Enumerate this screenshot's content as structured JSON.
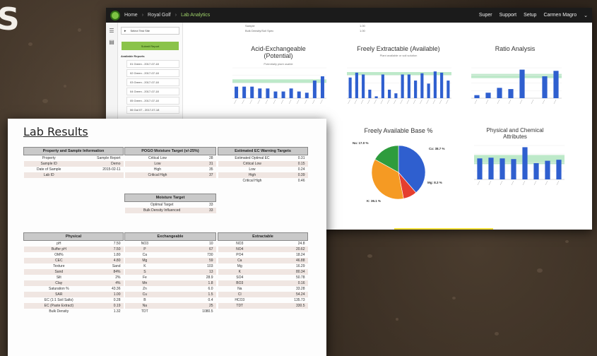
{
  "overlay_letter": "S",
  "dashboard": {
    "breadcrumbs": [
      "Home",
      "Royal Golf",
      "Lab Analytics"
    ],
    "topnav": [
      "Super",
      "Support",
      "Setup",
      "Carmen Magro"
    ],
    "sidepanel": {
      "select_label": "Select Test Site",
      "button_label": "Submit Report",
      "section_heading": "Available Reports",
      "reports": [
        "01 Green - 2017-07-18",
        "02 Green - 2017-07-18",
        "03 Green - 2017-07-18",
        "04 Green - 2017-07-18",
        "05 Green - 2017-07-18",
        "06 Gal 07 - 2017-07-18"
      ]
    },
    "top_notes": [
      "Sample",
      "1.00",
      "Bulk Density/Soil Spec",
      "1.00"
    ],
    "charts": {
      "acid": {
        "title_line1": "Acid-Exchangeable",
        "title_line2": "(Potential)",
        "subtitle": "Potentially plant usable"
      },
      "freely": {
        "title": "Freely Extractable (Available)",
        "subtitle": "Plant available or soil solution"
      },
      "ratio": {
        "title": "Ratio Analysis"
      },
      "base": {
        "title": "Freely Available Base %"
      },
      "physical": {
        "title_line1": "Physical and Chemical",
        "title_line2": "Attributes"
      }
    },
    "colors": {
      "bar": "#2f5fcf",
      "target_band": "#bde9c9",
      "topbar": "#1b1b1b",
      "accent": "#7cc242",
      "highlight": "#f4e13a"
    }
  },
  "chart_data": [
    {
      "type": "bar",
      "title": "Acid-Exchangeable (Potential)",
      "categories": [
        "a",
        "b",
        "c",
        "d",
        "e",
        "f",
        "g",
        "h",
        "i",
        "j",
        "k",
        "l"
      ],
      "values": [
        19,
        19,
        19,
        16,
        16,
        11,
        11,
        16,
        11,
        9,
        29,
        36
      ],
      "ylim": [
        0,
        50
      ],
      "target_band": [
        25,
        31
      ]
    },
    {
      "type": "bar",
      "title": "Freely Extractable (Available)",
      "categories": [
        "a",
        "b",
        "c",
        "d",
        "e",
        "f",
        "g",
        "h",
        "i",
        "j",
        "k",
        "l",
        "m",
        "n",
        "o",
        "p"
      ],
      "values": [
        34,
        42,
        39,
        14,
        3,
        39,
        14,
        8,
        39,
        39,
        29,
        41,
        24,
        44,
        42,
        29
      ],
      "ylim": [
        0,
        50
      ],
      "target_band": [
        38,
        43
      ]
    },
    {
      "type": "bar",
      "title": "Ratio Analysis",
      "categories": [
        "a",
        "b",
        "c",
        "d",
        "e",
        "f",
        "g",
        "h"
      ],
      "values": [
        5,
        9,
        17,
        15,
        47,
        0,
        36,
        45
      ],
      "ylim": [
        0,
        50
      ],
      "target_band": [
        33,
        40
      ]
    },
    {
      "type": "pie",
      "title": "Freely Available Base %",
      "slices": [
        {
          "label": "Ca: 38.7 %",
          "value": 38.7,
          "color": "#2f5fcf"
        },
        {
          "label": "Mg: 8.3 %",
          "value": 8.3,
          "color": "#e53e2f"
        },
        {
          "label": "K: 36.1 %",
          "value": 36.1,
          "color": "#f59a23"
        },
        {
          "label": "Na: 17.0 %",
          "value": 17.0,
          "color": "#2e9c3d"
        }
      ]
    },
    {
      "type": "bar",
      "title": "Physical and Chemical Attributes",
      "categories": [
        "a",
        "b",
        "c",
        "d",
        "e",
        "f",
        "g",
        "h"
      ],
      "values": [
        62,
        64,
        62,
        60,
        95,
        48,
        55,
        58
      ],
      "ylim": [
        0,
        100
      ],
      "target_band": [
        45,
        72
      ]
    }
  ],
  "lab": {
    "title": "Lab Results",
    "property_section": {
      "header": "Property and Sample Information",
      "rows": [
        [
          "Property",
          "Sample Report"
        ],
        [
          "Sample ID",
          "Demo"
        ],
        [
          "Date of Sample",
          "2015-02-11"
        ],
        [
          "Lab ID",
          ""
        ]
      ]
    },
    "pogo_section": {
      "header": "POGO Moisture Target (v/-25%)",
      "rows": [
        [
          "Critical Low",
          "28"
        ],
        [
          "Low",
          "31"
        ],
        [
          "High",
          "35"
        ],
        [
          "Critical High",
          "37"
        ]
      ]
    },
    "moisture_section": {
      "header": "Moisture Target",
      "rows": [
        [
          "Optimal Target",
          "33"
        ],
        [
          "Bulk Density Influenced",
          "33"
        ]
      ]
    },
    "ec_section": {
      "header": "Estimated EC Warning Targets",
      "rows": [
        [
          "Estimated Optimal EC",
          "0.31"
        ],
        [
          "Critical Low",
          "0.15"
        ],
        [
          "Low",
          "0.24"
        ],
        [
          "High",
          "0.39"
        ],
        [
          "Critical High",
          "0.46"
        ]
      ]
    },
    "physical": {
      "header": "Physical",
      "rows": [
        [
          "pH",
          "7.50"
        ],
        [
          "Buffer pH",
          "7.50"
        ],
        [
          "OM%",
          "1.80"
        ],
        [
          "CEC",
          "4.80"
        ],
        [
          "Texture",
          "Sand"
        ],
        [
          "Sand",
          "84%"
        ],
        [
          "Silt",
          "2%"
        ],
        [
          "Clay",
          "4%"
        ],
        [
          "Saturation %",
          "43.36"
        ],
        [
          "SAR",
          "1.00"
        ],
        [
          "EC (1:1 Soil Salts)",
          "0.28"
        ],
        [
          "EC (Paste Extract)",
          "0.19"
        ],
        [
          "Bulk Density",
          "1.32"
        ]
      ]
    },
    "exchangeable": {
      "header": "Exchangeable",
      "rows": [
        [
          "NO3",
          "10"
        ],
        [
          "P",
          "67"
        ],
        [
          "Ca",
          "730"
        ],
        [
          "Mg",
          "59"
        ],
        [
          "K",
          "103"
        ],
        [
          "S",
          "13"
        ],
        [
          "Fe",
          "28.9"
        ],
        [
          "Mn",
          "1.8"
        ],
        [
          "Zn",
          "6.0"
        ],
        [
          "Cu",
          "1.5"
        ],
        [
          "B",
          "0.4"
        ],
        [
          "Na",
          "25"
        ],
        [
          "TDT",
          "1080.5"
        ]
      ]
    },
    "extractable": {
      "header": "Extractable",
      "rows": [
        [
          "NO3",
          "24.8"
        ],
        [
          "NO4",
          "20.62"
        ],
        [
          "PO4",
          "18.24"
        ],
        [
          "Ca",
          "46.88"
        ],
        [
          "Mg",
          "16.29"
        ],
        [
          "K",
          "80.34"
        ],
        [
          "SO4",
          "50.78"
        ],
        [
          "BO3",
          "0.16"
        ],
        [
          "Na",
          "33.28"
        ],
        [
          "Cl",
          "54.24"
        ],
        [
          "HCO3",
          "135.73"
        ],
        [
          "TDT",
          "330.5"
        ]
      ]
    }
  }
}
